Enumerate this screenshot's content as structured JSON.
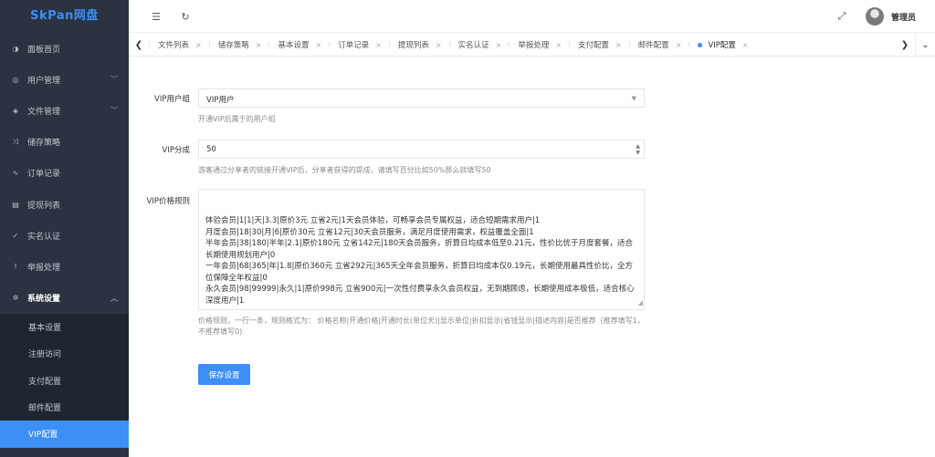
{
  "brand": "SkPan网盘",
  "sidebar": {
    "items": [
      {
        "label": "面板首页",
        "icon": "dashboard-icon",
        "glyph": "◑",
        "chevron": false
      },
      {
        "label": "用户管理",
        "icon": "user-icon",
        "glyph": "◎",
        "chevron": true
      },
      {
        "label": "文件管理",
        "icon": "stack-icon",
        "glyph": "◈",
        "chevron": true
      },
      {
        "label": "储存策略",
        "icon": "shuffle-icon",
        "glyph": "⤨",
        "chevron": false
      },
      {
        "label": "订单记录",
        "icon": "activity-icon",
        "glyph": "∿",
        "chevron": false
      },
      {
        "label": "提现列表",
        "icon": "document-icon",
        "glyph": "▤",
        "chevron": false
      },
      {
        "label": "实名认证",
        "icon": "verified-icon",
        "glyph": "✓",
        "chevron": false
      },
      {
        "label": "举报处理",
        "icon": "alert-icon",
        "glyph": "!",
        "chevron": false
      },
      {
        "label": "系统设置",
        "icon": "settings-icon",
        "glyph": "✲",
        "chevron": true,
        "open": true
      }
    ],
    "sub_items": [
      "基本设置",
      "注册访问",
      "支付配置",
      "邮件配置",
      "VIP配置"
    ],
    "active_sub": "VIP配置"
  },
  "header": {
    "menu_icon": "☰",
    "refresh_icon": "↻",
    "fullscreen_icon": "⤢",
    "username": "管理员"
  },
  "tabs": {
    "items": [
      "文件列表",
      "储存策略",
      "基本设置",
      "订单记录",
      "提现列表",
      "实名认证",
      "举报处理",
      "支付配置",
      "邮件配置",
      "VIP配置"
    ],
    "active": "VIP配置",
    "close_glyph": "×"
  },
  "form": {
    "vip_group": {
      "label": "VIP用户组",
      "value": "VIP用户",
      "help": "开通VIP后属于的用户组"
    },
    "vip_share": {
      "label": "VIP分成",
      "value": "50",
      "help": "游客通过分享者的链接开通VIP后，分享者获得的提成，请填写百分比如50%那么就填写50"
    },
    "vip_price_rules": {
      "label": "VIP价格规则",
      "value": "体验会员|1|1|天|3.3|原价3元 立省2元|1天会员体验，可畅享会员专属权益，适合短期需求用户|1\n月度会员|18|30|月|6|原价30元 立省12元|30天会员服务，满足月度使用需求，权益覆盖全面|1\n半年会员|38|180|半年|2.1|原价180元 立省142元|180天会员服务，折算日均成本低至0.21元，性价比优于月度套餐，适合长期使用规划用户|0\n一年会员|68|365|年|1.8|原价360元 立省292元|365天全年会员服务，折算日均成本仅0.19元，长期使用最具性价比，全方位保障全年权益|0\n永久会员|98|99999|永久|1|原价998元 立省900元|一次性付费享永久会员权益，无到期顾虑，长期使用成本极低，适合核心深度用户|1",
      "help": "价格规则，一行一条，规则格式为： 价格名称|开通价格|开通时长(单位天)|显示单位|折扣显示|省钱显示|描述内容|是否推荐（推荐填写1，不推荐填写0)"
    },
    "save_label": "保存设置"
  }
}
